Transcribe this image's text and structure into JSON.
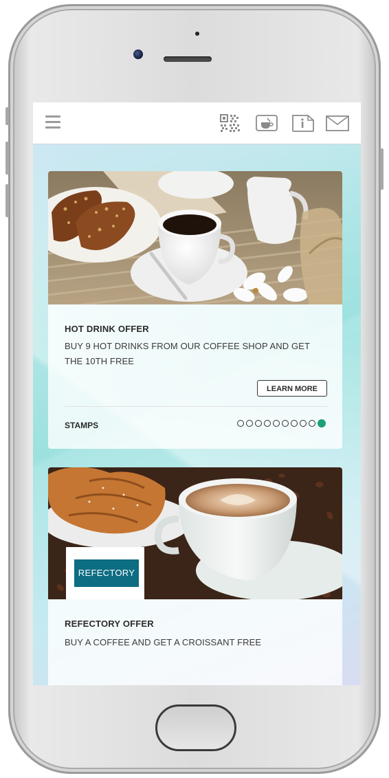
{
  "app": {
    "topbar": {
      "icons": [
        "menu-icon",
        "qr-code-icon",
        "cup-icon",
        "info-icon",
        "mail-icon"
      ]
    }
  },
  "offers": [
    {
      "title": "HOT DRINK OFFER",
      "description": "BUY 9 HOT DRINKS FROM OUR COFFEE SHOP AND GET THE 10TH FREE",
      "button_label": "LEARN MORE",
      "stamps_label": "STAMPS",
      "stamps_total": 10,
      "stamps_collected": 1
    },
    {
      "title": "REFECTORY OFFER",
      "description": "BUY A COFFEE AND GET A CROISSANT FREE",
      "logo_text": "REFECTORY"
    }
  ],
  "colors": {
    "stamp_filled": "#1aa07a",
    "logo_bg": "#0d6d82"
  }
}
